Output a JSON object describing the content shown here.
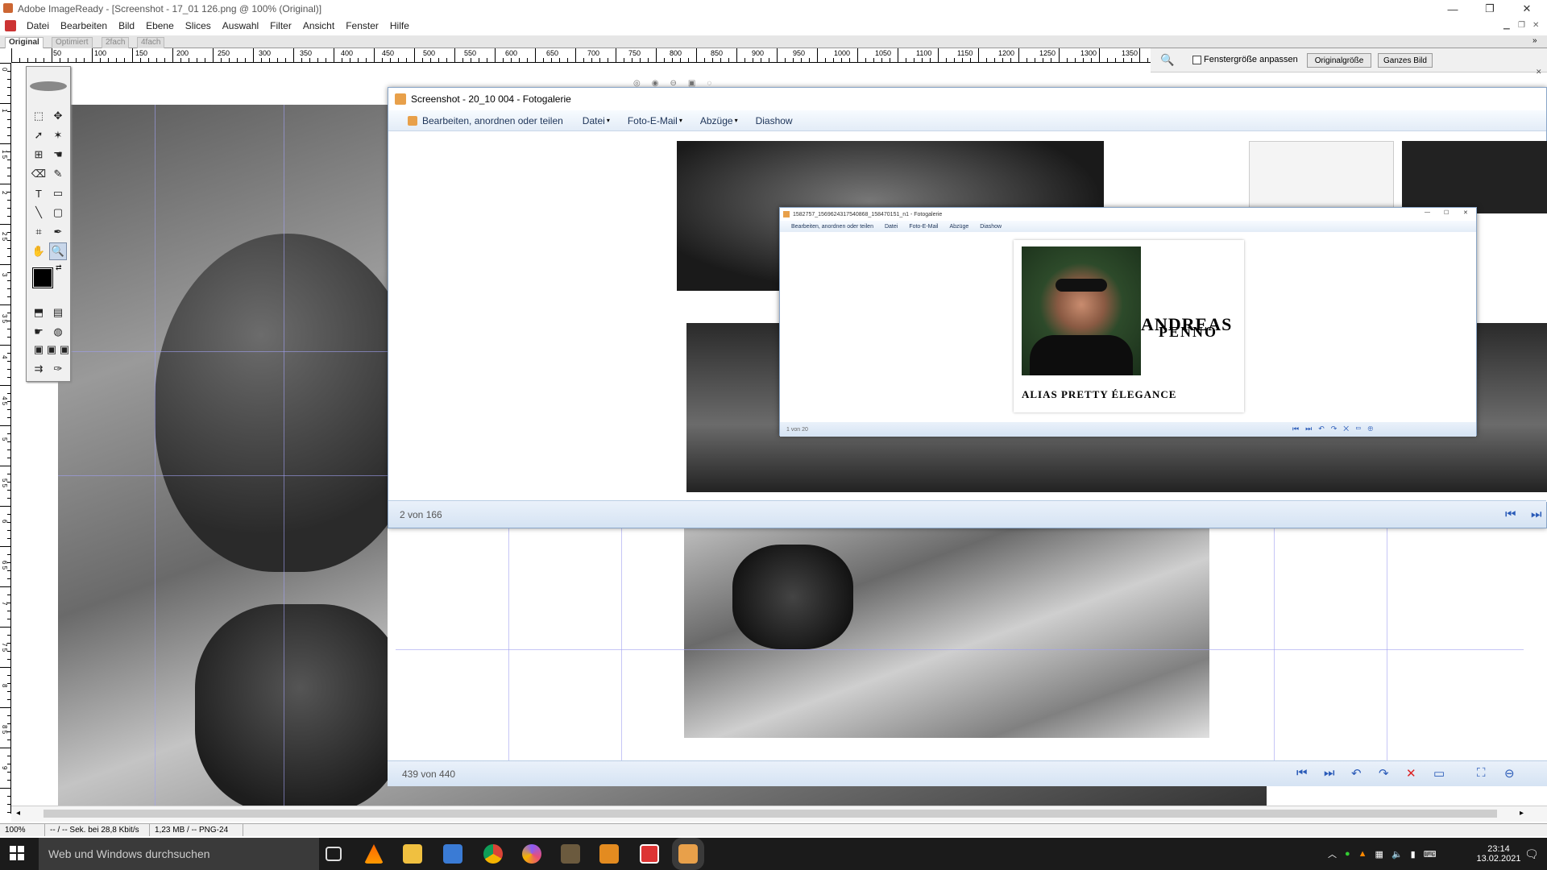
{
  "app": {
    "title": "Adobe ImageReady - [Screenshot - 17_01 126.png @ 100% (Original)]",
    "menu": [
      "Datei",
      "Bearbeiten",
      "Bild",
      "Ebene",
      "Slices",
      "Auswahl",
      "Filter",
      "Ansicht",
      "Fenster",
      "Hilfe"
    ],
    "view_tabs": [
      "Original",
      "Optimiert",
      "2fach",
      "4fach"
    ],
    "ruler_labels": [
      "50",
      "100",
      "150",
      "200",
      "250",
      "300",
      "350",
      "400",
      "450",
      "500",
      "550",
      "600",
      "650",
      "700",
      "750",
      "800",
      "850",
      "900",
      "950",
      "1000",
      "1050",
      "1100",
      "1150",
      "1200",
      "1250",
      "1300",
      "1350"
    ],
    "vruler_labels": [
      "0",
      "1",
      "1 5",
      "2",
      "2 5",
      "3",
      "3 5",
      "4",
      "4 5",
      "5",
      "5 5",
      "6",
      "6 5",
      "7",
      "7 5",
      "8",
      "8 5",
      "9"
    ],
    "toolbar_right": {
      "fit_window_label": "Fenstergröße anpassen",
      "original_size_label": "Originalgröße",
      "whole_image_label": "Ganzes Bild"
    },
    "status": {
      "zoom": "100%",
      "speed": "-- / -- Sek. bei 28,8 Kbit/s",
      "size": "1,23 MB / -- PNG-24"
    }
  },
  "gallery_main": {
    "title": "Screenshot - 20_10 004 - Fotogalerie",
    "toolbar": [
      "Bearbeiten, anordnen oder teilen",
      "Datei",
      "Foto-E-Mail",
      "Abzüge",
      "Diashow"
    ],
    "counter": "2 von 166"
  },
  "gallery_second": {
    "counter": "439 von 440"
  },
  "gallery_nested": {
    "title": "1582757_1569624317540868_158470151_n1 - Fotogalerie",
    "toolbar": [
      "Bearbeiten, anordnen oder teilen",
      "Datei",
      "Foto-E-Mail",
      "Abzüge",
      "Diashow"
    ],
    "counter": "1 von 20",
    "card_name_1": "ANDREAS",
    "card_name_2": "PENNO",
    "card_alias": "ALIAS PRETTY ÉLEGANCE"
  },
  "taskbar": {
    "search_placeholder": "Web und Windows durchsuchen",
    "time": "23:14",
    "date": "13.02.2021"
  }
}
